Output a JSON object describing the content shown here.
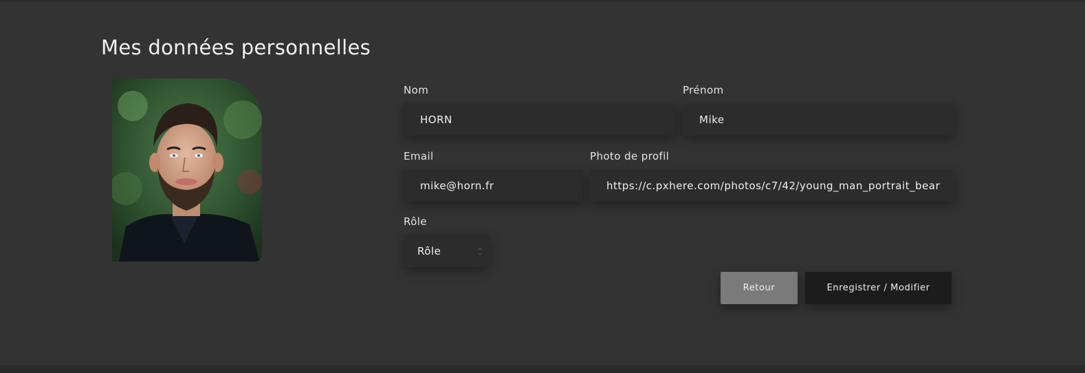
{
  "page": {
    "title": "Mes données personnelles"
  },
  "profile_photo": {
    "alt": "young man portrait bearded"
  },
  "form": {
    "nom": {
      "label": "Nom",
      "value": "HORN"
    },
    "prenom": {
      "label": "Prénom",
      "value": "Mike"
    },
    "email": {
      "label": "Email",
      "value": "mike@horn.fr"
    },
    "photo": {
      "label": "Photo de profil",
      "value": "https://c.pxhere.com/photos/c7/42/young_man_portrait_bear"
    },
    "role": {
      "label": "Rôle",
      "selected": "Rôle"
    }
  },
  "buttons": {
    "back": "Retour",
    "save": "Enregistrer / Modifier"
  },
  "colors": {
    "background": "#333333",
    "field_bg": "#2c2c2c",
    "back_button": "#7a7a7a",
    "save_button": "#1c1c1c"
  }
}
